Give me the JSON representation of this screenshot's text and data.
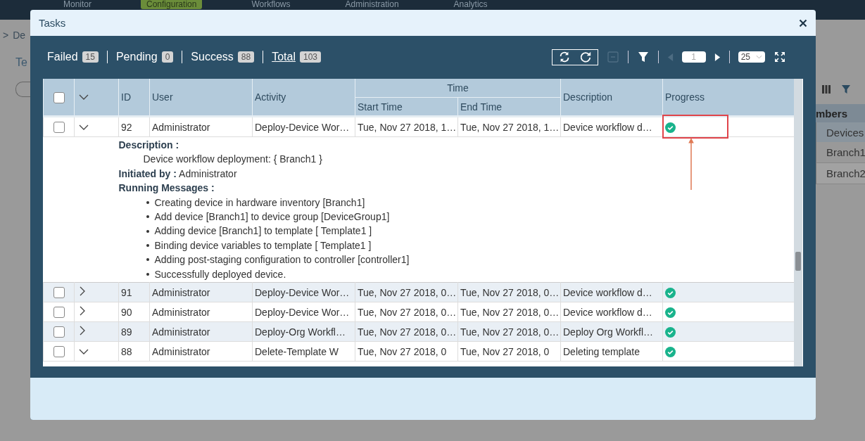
{
  "background": {
    "nav": [
      {
        "label": "Monitor",
        "selected": false
      },
      {
        "label": "Configuration",
        "selected": true
      },
      {
        "label": "Workflows",
        "selected": false
      },
      {
        "label": "Administration",
        "selected": false
      },
      {
        "label": "Analytics",
        "selected": false
      }
    ],
    "breadcrumb": {
      "separator": ">",
      "item": "De"
    },
    "tab": "Te",
    "table_header": "mbers",
    "column": "Devices",
    "rows": [
      "Branch1",
      "Branch2"
    ]
  },
  "dialog": {
    "title": "Tasks",
    "counts": [
      {
        "label": "Failed",
        "count": "15",
        "selected": false
      },
      {
        "label": "Pending",
        "count": "0",
        "selected": false
      },
      {
        "label": "Success",
        "count": "88",
        "selected": false
      },
      {
        "label": "Total",
        "count": "103",
        "selected": true
      }
    ],
    "pager": {
      "page": "1",
      "page_size": "25",
      "prev_disabled": true,
      "collapse_disabled": true
    },
    "table": {
      "select_all_checked": false,
      "columns": {
        "id": "ID",
        "user": "User",
        "activity": "Activity",
        "time": "Time",
        "start": "Start Time",
        "end": "End Time",
        "description": "Description",
        "progress": "Progress"
      },
      "rows": [
        {
          "id": "92",
          "user": "Administrator",
          "activity": "Deploy-Device Wor…",
          "start": "Tue, Nov 27 2018, 1…",
          "end": "Tue, Nov 27 2018, 1…",
          "description": "Device workflow d…",
          "kind": "success",
          "checked": false,
          "expanded": true,
          "highlighted": true,
          "details": {
            "description_label": "Description :",
            "description": "Device workflow deployment: { Branch1 }",
            "initiated_label": "Initiated by :",
            "initiated_by": "Administrator",
            "messages_label": "Running Messages :",
            "messages": [
              "Creating device in hardware inventory [Branch1]",
              "Add device [Branch1] to device group [DeviceGroup1]",
              "Adding device [Branch1] to template [ Template1 ]",
              "Binding device variables to template [ Template1 ]",
              "Adding post-staging configuration to controller [controller1]",
              "Successfully deployed device."
            ]
          }
        },
        {
          "id": "91",
          "user": "Administrator",
          "activity": "Deploy-Device Wor…",
          "start": "Tue, Nov 27 2018, 0…",
          "end": "Tue, Nov 27 2018, 0…",
          "description": "Device workflow d…",
          "kind": "success",
          "checked": false,
          "expanded": false,
          "highlighted": false
        },
        {
          "id": "90",
          "user": "Administrator",
          "activity": "Deploy-Device Wor…",
          "start": "Tue, Nov 27 2018, 0…",
          "end": "Tue, Nov 27 2018, 0…",
          "description": "Device workflow d…",
          "kind": "success",
          "checked": false,
          "expanded": false,
          "highlighted": false
        },
        {
          "id": "89",
          "user": "Administrator",
          "activity": "Deploy-Org Workfl…",
          "start": "Tue, Nov 27 2018, 0…",
          "end": "Tue, Nov 27 2018, 0…",
          "description": "Deploy Org Workfl…",
          "kind": "success",
          "checked": false,
          "expanded": false,
          "highlighted": false
        },
        {
          "id": "88",
          "user": "Administrator",
          "activity": "Delete-Template W",
          "start": "Tue, Nov 27 2018, 0",
          "end": "Tue, Nov 27 2018, 0",
          "description": "Deleting template",
          "kind": "success",
          "checked": false,
          "expanded": true,
          "highlighted": false
        }
      ]
    }
  }
}
